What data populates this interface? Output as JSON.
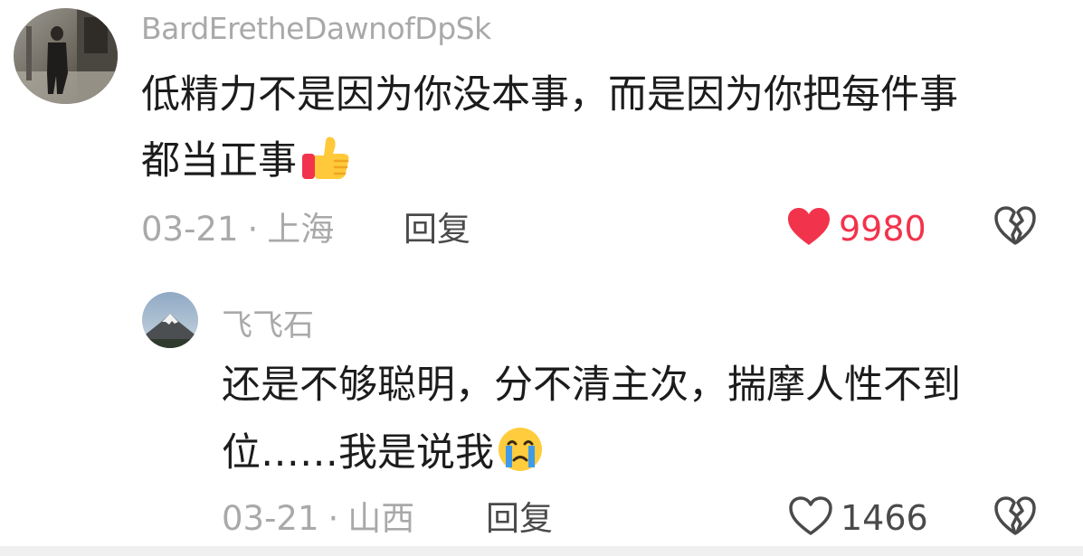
{
  "comments": [
    {
      "username": "BardEretheDawnofDpSk",
      "text_line1": "低精力不是因为你没本事，而是因为你把每件事",
      "text_line2": "都当正事",
      "emoji": "thumbs-up",
      "date": "03-21",
      "separator": "·",
      "location": "上海",
      "reply_label": "回复",
      "like_count": "9980",
      "liked": true,
      "like_color": "#f2334c"
    },
    {
      "username": "飞飞石",
      "text_line1": "还是不够聪明，分不清主次，揣摩人性不到",
      "text_line2": "位……我是说我",
      "emoji": "crying-face",
      "date": "03-21",
      "separator": "·",
      "location": "山西",
      "reply_label": "回复",
      "like_count": "1466",
      "liked": false
    }
  ]
}
